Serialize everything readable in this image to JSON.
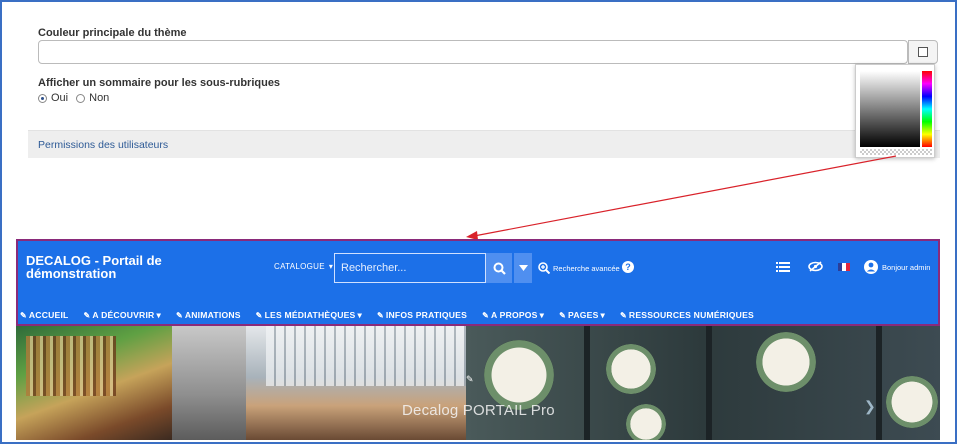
{
  "settings": {
    "theme_color_label": "Couleur principale du thème",
    "theme_color_value": "",
    "summary_label": "Afficher un sommaire pour les sous-rubriques",
    "options": [
      {
        "label": "Oui",
        "selected": true
      },
      {
        "label": "Non",
        "selected": false
      }
    ],
    "permissions_label": "Permissions des utilisateurs"
  },
  "portal": {
    "title_line1": "DECALOG - Portail de",
    "title_line2": "démonstration",
    "catalogue_label": "CATALOGUE",
    "search_placeholder": "Rechercher...",
    "advanced_search": "Recherche avancée",
    "greeting": "Bonjour admin",
    "nav": [
      {
        "label": "ACCUEIL",
        "dropdown": false
      },
      {
        "label": "A DÉCOUVRIR",
        "dropdown": true
      },
      {
        "label": "ANIMATIONS",
        "dropdown": false
      },
      {
        "label": "LES MÉDIATHÈQUES",
        "dropdown": true
      },
      {
        "label": "INFOS PRATIQUES",
        "dropdown": false
      },
      {
        "label": "A PROPOS",
        "dropdown": true
      },
      {
        "label": "PAGES",
        "dropdown": true
      },
      {
        "label": "RESSOURCES NUMÉRIQUES",
        "dropdown": false
      }
    ]
  },
  "banner": {
    "caption": "Decalog PORTAIL Pro"
  },
  "colors": {
    "header_bg": "#1c70e8",
    "header_border": "#8a2a7a",
    "arrow": "#d9222a",
    "frame": "#3a6fc4"
  },
  "icons": {
    "picker_button": "color-picker-icon",
    "search": "search-icon",
    "dropdown": "caret-down-icon",
    "advanced": "zoom-plus-icon",
    "help": "question-icon",
    "list": "list-icon",
    "visibility": "eye-slash-icon",
    "language": "french-flag-icon",
    "user": "user-icon"
  }
}
